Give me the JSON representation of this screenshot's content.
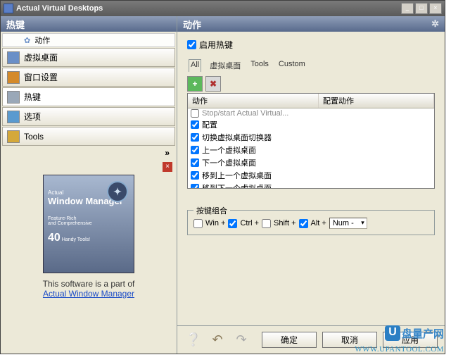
{
  "title": "Actual Virtual Desktops",
  "left": {
    "header": "热键",
    "sub": "动作",
    "items": [
      {
        "label": "虚拟桌面",
        "icon_color": "#6a8fc7"
      },
      {
        "label": "窗口设置",
        "icon_color": "#d48a2a"
      },
      {
        "label": "热键",
        "icon_color": "#9aa8b8",
        "active": true
      },
      {
        "label": "选项",
        "icon_color": "#5a9acf"
      },
      {
        "label": "Tools",
        "icon_color": "#d4a83a"
      }
    ],
    "expand": "»"
  },
  "promo": {
    "brand_small": "Actual",
    "brand_big": "Window Manager",
    "tag1": "Feature-Rich",
    "tag2": "and Comprehensive",
    "tag3": "Handy Tools!",
    "num": "40",
    "text": "This software is a part of",
    "link": "Actual Window Manager"
  },
  "right": {
    "header": "动作",
    "enable": "启用热键",
    "tabs": [
      "All",
      "虚拟桌面",
      "Tools",
      "Custom"
    ],
    "columns": [
      "动作",
      "配置动作"
    ],
    "rows": [
      {
        "checked": false,
        "label": "Stop/start Actual Virtual...",
        "sel": true
      },
      {
        "checked": true,
        "label": "配置"
      },
      {
        "checked": true,
        "label": "切换虚拟桌面切换器"
      },
      {
        "checked": true,
        "label": "上一个虚拟桌面"
      },
      {
        "checked": true,
        "label": "下一个虚拟桌面"
      },
      {
        "checked": true,
        "label": "移到上一个虚拟桌面"
      },
      {
        "checked": true,
        "label": "移到下一个虚拟桌面"
      }
    ],
    "group": "按键组合",
    "keys": {
      "win": {
        "label": "Win +",
        "checked": false
      },
      "ctrl": {
        "label": "Ctrl +",
        "checked": true
      },
      "shift": {
        "label": "Shift +",
        "checked": false
      },
      "alt": {
        "label": "Alt +",
        "checked": true
      },
      "num": "Num -"
    }
  },
  "buttons": {
    "ok": "确定",
    "cancel": "取消",
    "apply": "应用"
  },
  "watermark": {
    "brand": "盘量产网",
    "url": "WWW.UPANTOOL.COM"
  }
}
